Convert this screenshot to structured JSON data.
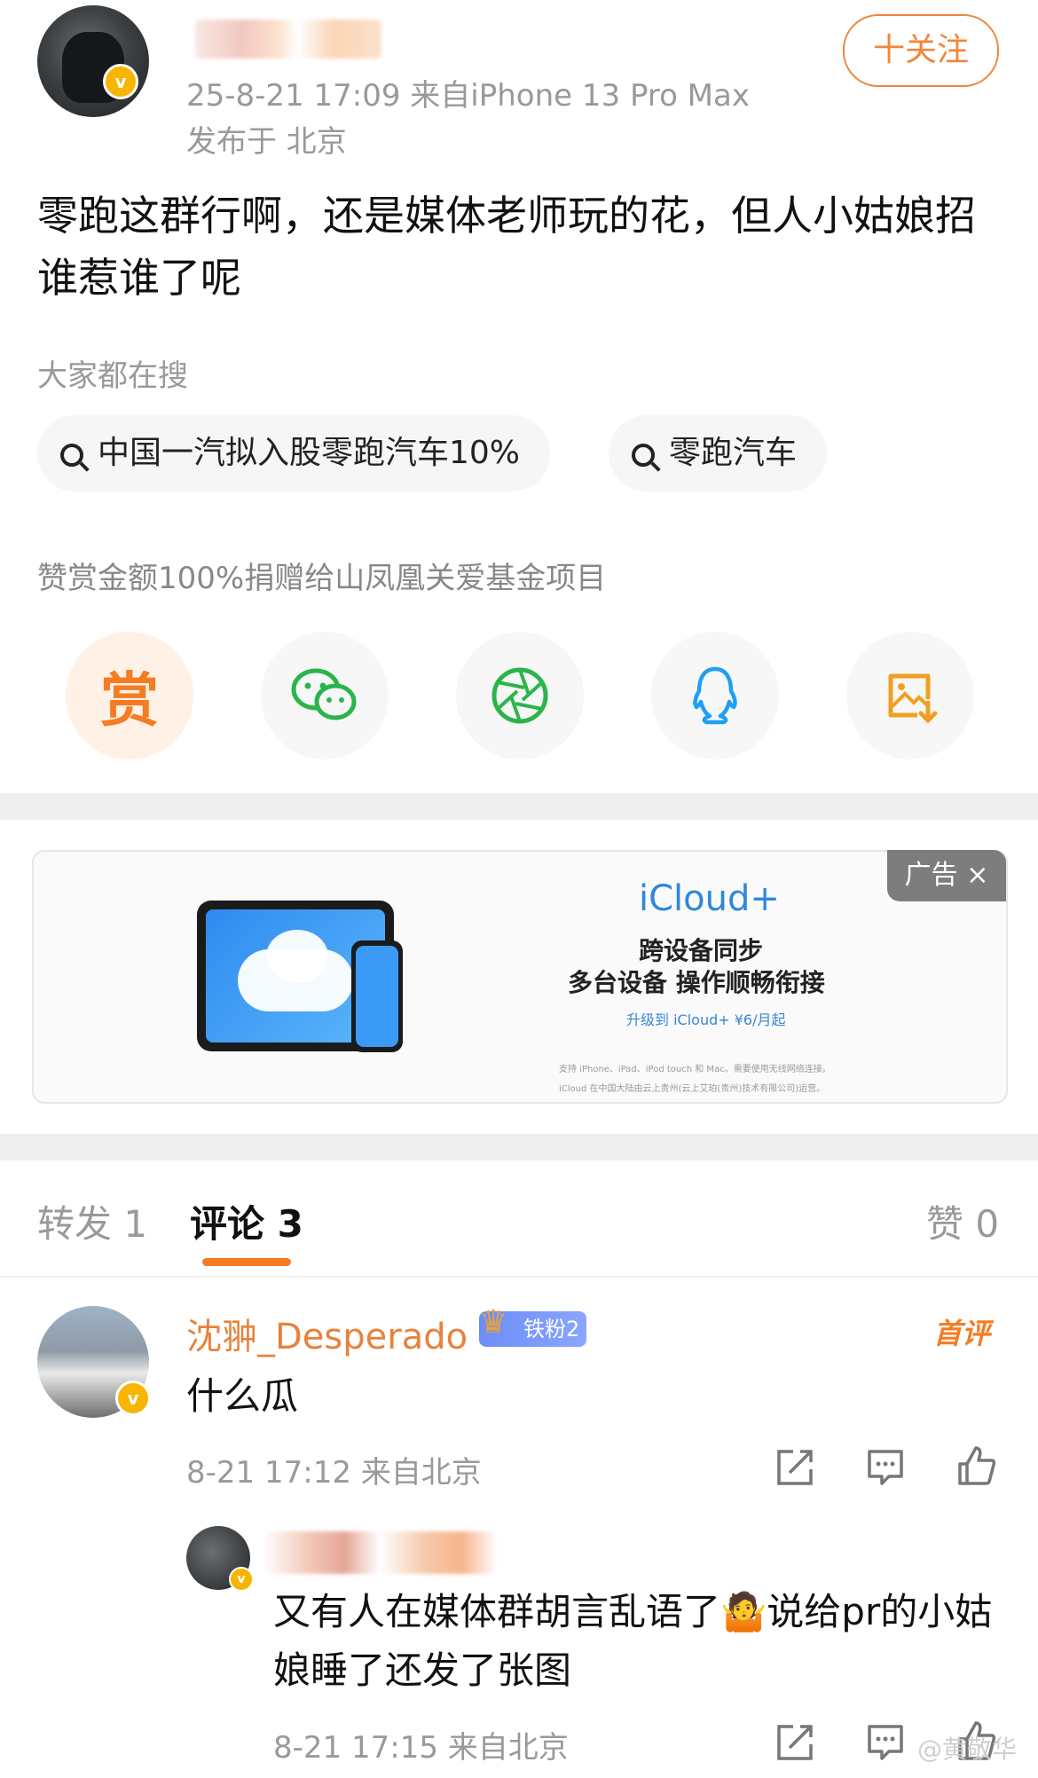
{
  "post": {
    "meta_time_device": "25-8-21 17:09  来自iPhone 13 Pro Max",
    "meta_location": "发布于 北京",
    "follow_label": "十关注",
    "text": "零跑这群行啊，还是媒体老师玩的花，但人小姑娘招谁惹谁了呢"
  },
  "search": {
    "title": "大家都在搜",
    "chips": [
      "中国一汽拟入股零跑汽车10%",
      "零跑汽车"
    ]
  },
  "donate_text": "赞赏金额100%捐赠给山凤凰关爱基金项目",
  "share": {
    "reward_char": "赏"
  },
  "ad": {
    "badge": "广告 ×",
    "title": "iCloud+",
    "line1": "跨设备同步",
    "line2": "多台设备 操作顺畅衔接",
    "line3": "升级到 iCloud+ ¥6/月起",
    "fine1": "支持 iPhone、iPad、iPod touch 和 Mac。需要使用无线网络连接。",
    "fine2": "iCloud 在中国大陆由云上贵州(云上艾珀(贵州)技术有限公司)运营。"
  },
  "tabs": {
    "repost": "转发 1",
    "comments": "评论 3",
    "likes": "赞 0"
  },
  "comment": {
    "name": "沈翀_Desperado",
    "fan_badge": "铁粉2",
    "first_badge": "首评",
    "text": "什么瓜",
    "meta": "8-21 17:12  来自北京"
  },
  "reply": {
    "text": "又有人在媒体群胡言乱语了🤷说给pr的小姑娘睡了还发了张图",
    "meta": "8-21 17:15  来自北京"
  },
  "watermark": "@黄敬华"
}
